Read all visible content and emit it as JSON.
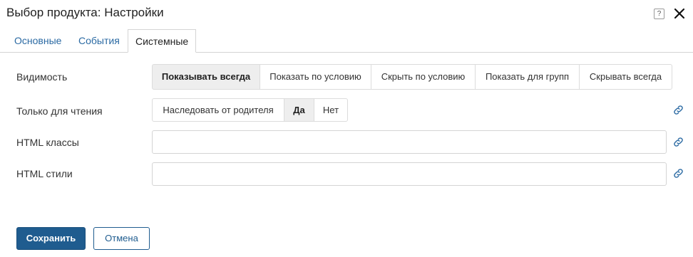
{
  "dialog": {
    "title": "Выбор продукта: Настройки",
    "help_icon_text": "?"
  },
  "tabs": [
    {
      "label": "Основные",
      "active": false
    },
    {
      "label": "События",
      "active": false
    },
    {
      "label": "Системные",
      "active": true
    }
  ],
  "visibility": {
    "label": "Видимость",
    "options": [
      "Показывать всегда",
      "Показать по условию",
      "Скрыть по условию",
      "Показать для групп",
      "Скрывать всегда"
    ],
    "selected": "Показывать всегда"
  },
  "readonly": {
    "label": "Только для чтения",
    "options": [
      "Наследовать от родителя",
      "Да",
      "Нет"
    ],
    "selected": "Да"
  },
  "html_classes": {
    "label": "HTML классы",
    "value": "",
    "placeholder": ""
  },
  "html_styles": {
    "label": "HTML стили",
    "value": "",
    "placeholder": ""
  },
  "footer": {
    "save_label": "Сохранить",
    "cancel_label": "Отмена"
  },
  "colors": {
    "primary": "#1f5c8f",
    "link": "#2b6aa3",
    "selected_segment_bg": "#eeeeee"
  },
  "icons": [
    "help-icon",
    "close-icon",
    "link-icon"
  ]
}
